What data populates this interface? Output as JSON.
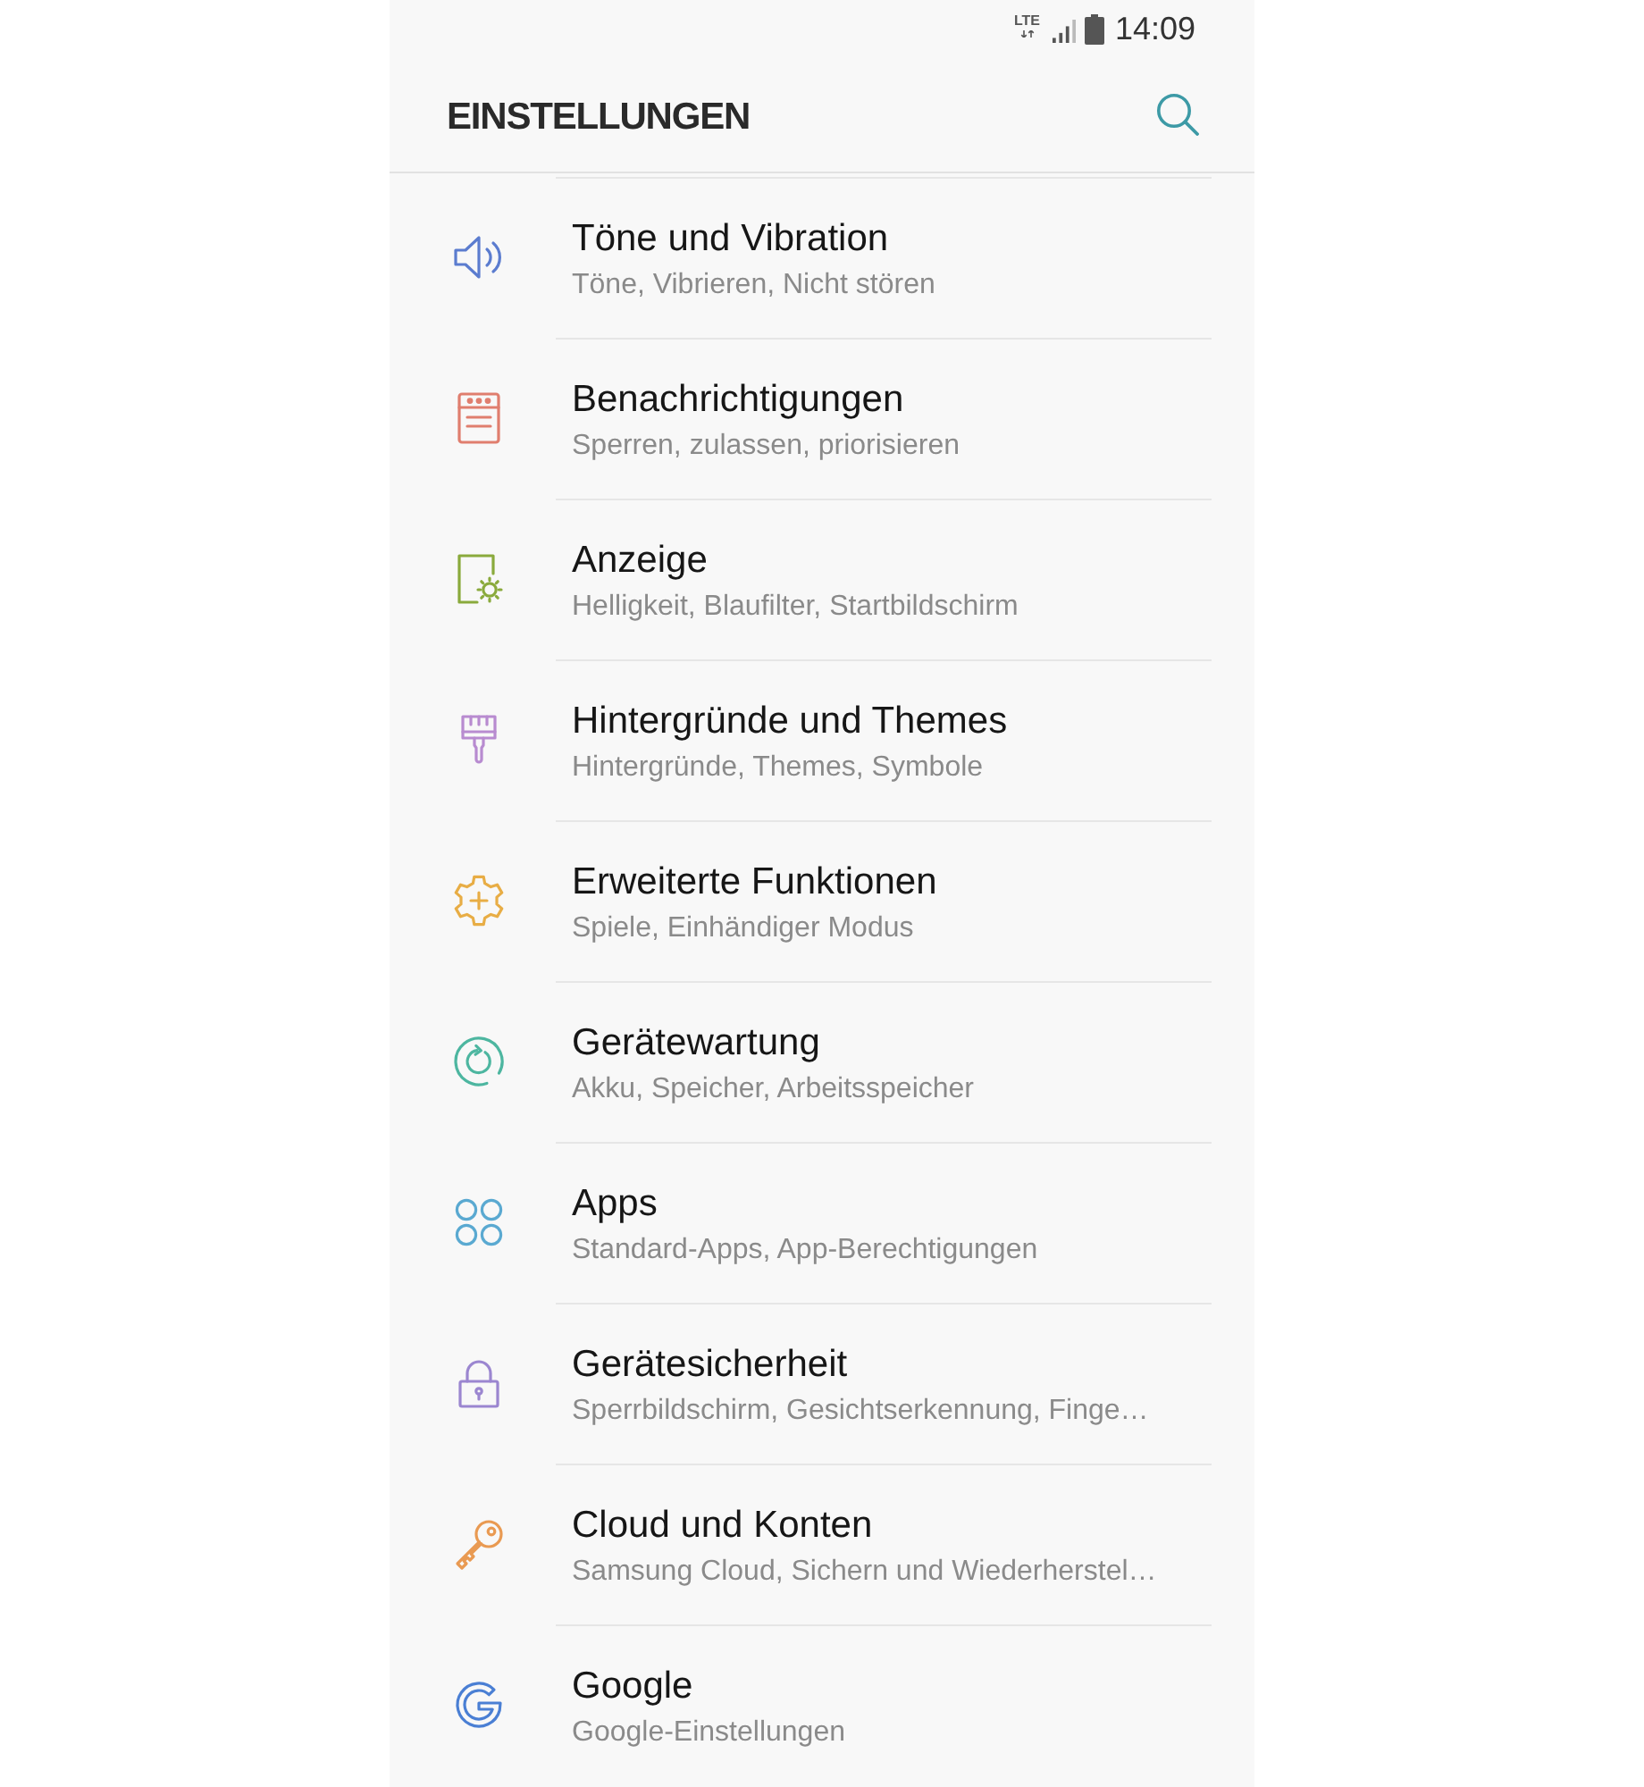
{
  "status_bar": {
    "network": "LTE",
    "time": "14:09"
  },
  "header": {
    "title": "EINSTELLUNGEN"
  },
  "settings": [
    {
      "kind": "sound",
      "color": "#5b7ccf",
      "title": "Töne und Vibration",
      "subtitle": "Töne, Vibrieren, Nicht stören"
    },
    {
      "kind": "notifications",
      "color": "#e07e6e",
      "title": "Benachrichtigungen",
      "subtitle": "Sperren, zulassen, priorisieren"
    },
    {
      "kind": "display",
      "color": "#8aaa3c",
      "title": "Anzeige",
      "subtitle": "Helligkeit, Blaufilter, Startbildschirm"
    },
    {
      "kind": "wallpaper",
      "color": "#b88bd0",
      "title": "Hintergründe und Themes",
      "subtitle": "Hintergründe, Themes, Symbole"
    },
    {
      "kind": "advanced",
      "color": "#e8ad45",
      "title": "Erweiterte Funktionen",
      "subtitle": "Spiele, Einhändiger Modus"
    },
    {
      "kind": "maintenance",
      "color": "#4db6a0",
      "title": "Gerätewartung",
      "subtitle": "Akku, Speicher, Arbeitsspeicher"
    },
    {
      "kind": "apps",
      "color": "#5aa9d1",
      "title": "Apps",
      "subtitle": "Standard-Apps, App-Berechtigungen"
    },
    {
      "kind": "security",
      "color": "#9b86d0",
      "title": "Gerätesicherheit",
      "subtitle": "Sperrbildschirm, Gesichtserkennung, Finge…"
    },
    {
      "kind": "accounts",
      "color": "#e99a52",
      "title": "Cloud und Konten",
      "subtitle": "Samsung Cloud, Sichern und Wiederherstel…"
    },
    {
      "kind": "google",
      "color": "#4a7fd4",
      "title": "Google",
      "subtitle": "Google-Einstellungen"
    }
  ]
}
